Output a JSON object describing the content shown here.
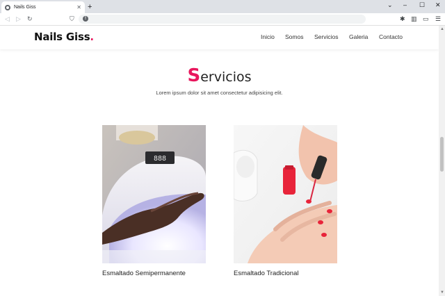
{
  "browser": {
    "tab_title": "Nails Giss",
    "tab_close": "✕",
    "new_tab": "+",
    "window_controls": {
      "chevron": "⌄",
      "minimize": "–",
      "maximize": "☐",
      "close": "✕"
    },
    "nav_icons": {
      "back": "◁",
      "forward": "▷",
      "reload": "↻",
      "bookmark": "⛉"
    },
    "omnibox_icon": "!",
    "toolbar_icons": {
      "extensions": "✱",
      "sidebar": "▥",
      "wallet": "▭",
      "menu": "☰"
    }
  },
  "site": {
    "logo": "Nails Giss",
    "logo_dot": ".",
    "nav": [
      "Inicio",
      "Somos",
      "Servicios",
      "Galeria",
      "Contacto"
    ]
  },
  "section": {
    "title_first": "S",
    "title_rest": "ervicios",
    "subtitle": "Lorem ipsum dolor sit amet consectetur adipisicing elit."
  },
  "cards": [
    {
      "label": "Esmaltado Semipermanente",
      "image": "uv-nail-lamp-photo"
    },
    {
      "label": "Esmaltado Tradicional",
      "image": "nail-polish-application-photo"
    }
  ],
  "lamp_display": "888",
  "colors": {
    "accent": "#e8175d",
    "polish_red": "#e8243a"
  }
}
